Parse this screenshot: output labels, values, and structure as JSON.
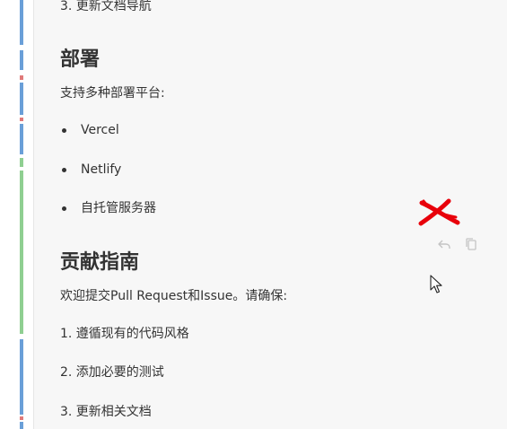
{
  "doc": {
    "top_item": "3. 更新文档导航",
    "deploy_heading": "部署",
    "deploy_intro": "支持多种部署平台:",
    "deploy_platforms": [
      "Vercel",
      "Netlify",
      "自托管服务器"
    ],
    "contrib_heading": "贡献指南",
    "contrib_intro": "欢迎提交Pull Request和Issue。请确保:",
    "contrib_items": [
      "1. 遵循现有的代码风格",
      "2. 添加必要的测试",
      "3. 更新相关文档"
    ]
  },
  "toolbar": {
    "reply_icon": "reply-icon",
    "copy_icon": "copy-icon"
  },
  "colors": {
    "mark": "#e8000b",
    "gutter_blue": "#6a9fd8",
    "gutter_green": "#8fcf91",
    "gutter_red": "#e07a7a"
  }
}
